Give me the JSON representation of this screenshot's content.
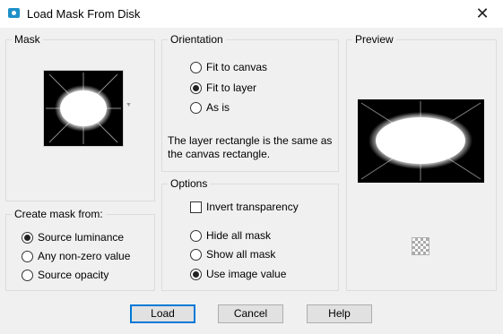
{
  "window": {
    "title": "Load Mask From Disk",
    "close_glyph": "✕"
  },
  "mask_group": {
    "label": "Mask"
  },
  "create_group": {
    "label": "Create mask from:",
    "options": [
      {
        "label": "Source luminance",
        "checked": true
      },
      {
        "label": "Any non-zero value",
        "checked": false
      },
      {
        "label": "Source opacity",
        "checked": false
      }
    ]
  },
  "orientation_group": {
    "label": "Orientation",
    "options": [
      {
        "label": "Fit to canvas",
        "checked": false
      },
      {
        "label": "Fit to layer",
        "checked": true
      },
      {
        "label": "As is",
        "checked": false
      }
    ],
    "info": "The layer rectangle is the same as the canvas rectangle."
  },
  "options_group": {
    "label": "Options",
    "invert_label": "Invert transparency",
    "invert_checked": false,
    "options": [
      {
        "label": "Hide all mask",
        "checked": false
      },
      {
        "label": "Show all mask",
        "checked": false
      },
      {
        "label": "Use image value",
        "checked": true
      }
    ]
  },
  "preview_group": {
    "label": "Preview"
  },
  "buttons": {
    "load": "Load",
    "cancel": "Cancel",
    "help": "Help"
  },
  "colors": {
    "accent": "#0078d7",
    "dialog_bg": "#f0f0f0",
    "border": "#dcdcdc"
  }
}
